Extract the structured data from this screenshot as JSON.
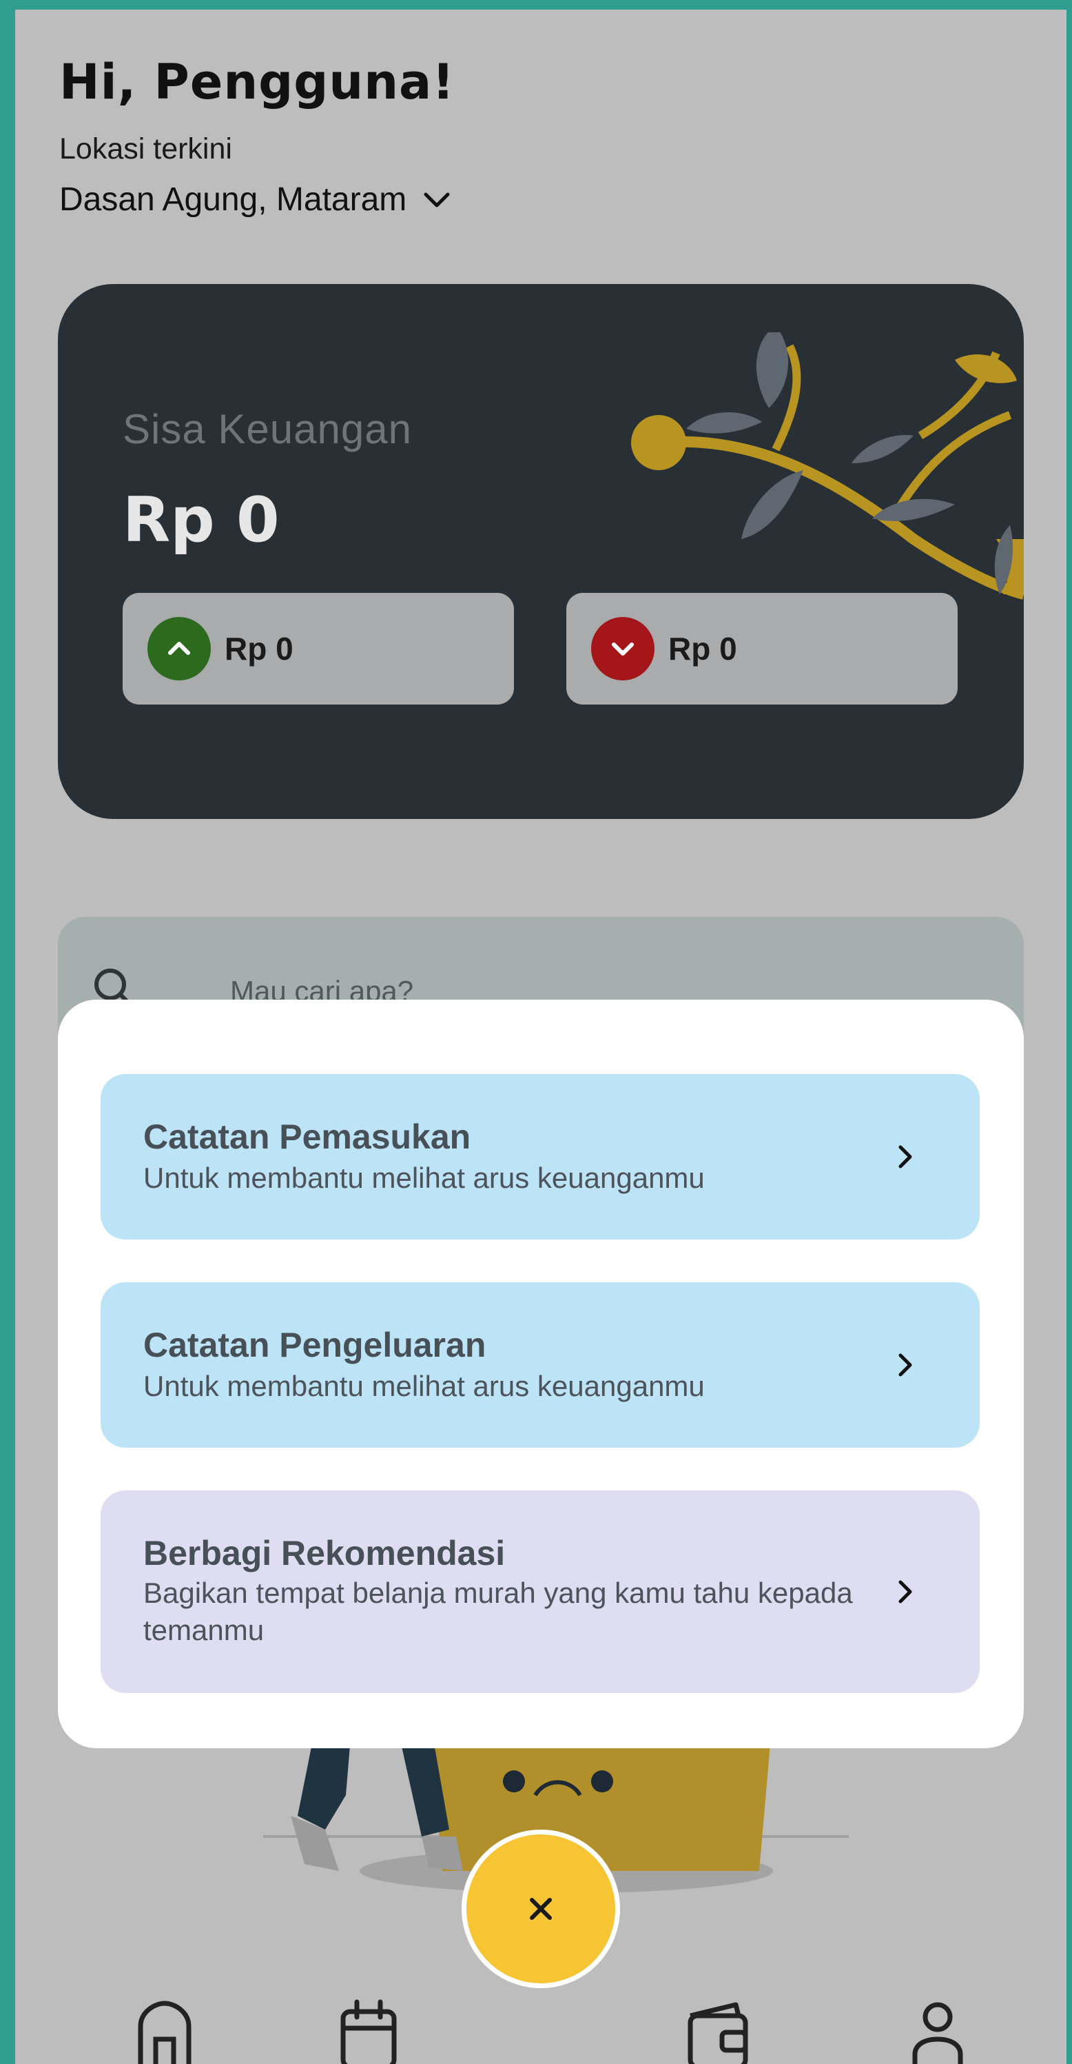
{
  "header": {
    "greeting": "Hi, Pengguna!",
    "location_label": "Lokasi terkini",
    "location_value": "Dasan Agung, Mataram"
  },
  "balance_card": {
    "label": "Sisa Keuangan",
    "value": "Rp 0",
    "income_amount": "Rp 0",
    "expense_amount": "Rp 0"
  },
  "search": {
    "placeholder": "Mau cari apa?"
  },
  "sheet": {
    "options": [
      {
        "title": "Catatan Pemasukan",
        "description": "Untuk membantu melihat arus keuanganmu"
      },
      {
        "title": "Catatan Pengeluaran",
        "description": "Untuk membantu melihat arus keuanganmu"
      },
      {
        "title": "Berbagi Rekomendasi",
        "description": "Bagikan tempat belanja murah yang kamu tahu kepada temanmu"
      }
    ]
  },
  "colors": {
    "accent": "#f7c433",
    "income": "#2c6b1e",
    "expense": "#a5161b",
    "card_dark": "#283035",
    "option_blue": "#bde3f7",
    "option_purple": "#deddf2"
  },
  "icons": {
    "location_dropdown": "chevron-down-icon",
    "income": "arrow-up-icon",
    "expense": "arrow-down-icon",
    "search": "search-icon",
    "option": "chevron-right-icon",
    "fab": "close-icon",
    "nav": [
      "home-icon",
      "calendar-icon",
      "wallet-icon",
      "profile-icon"
    ]
  }
}
